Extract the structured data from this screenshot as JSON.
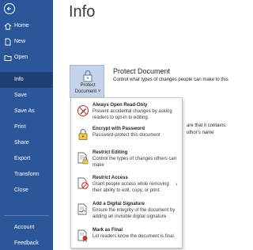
{
  "sidebar": {
    "items": [
      {
        "label": "Home"
      },
      {
        "label": "New"
      },
      {
        "label": "Open"
      },
      {
        "label": "Info"
      },
      {
        "label": "Save"
      },
      {
        "label": "Save As"
      },
      {
        "label": "Print"
      },
      {
        "label": "Share"
      },
      {
        "label": "Export"
      },
      {
        "label": "Transform"
      },
      {
        "label": "Close"
      },
      {
        "label": "Account"
      },
      {
        "label": "Feedback"
      }
    ],
    "active": "Info"
  },
  "main": {
    "title": "Info",
    "protect_button": {
      "line1": "Protect",
      "line2": "Document ˅"
    },
    "section_title": "Protect Document",
    "section_desc": "Control what types of changes people can make to this",
    "bg_text_1": "are that it contains:",
    "bg_text_2": "uthor's name"
  },
  "menu": {
    "items": [
      {
        "title": "Always Open Read-Only",
        "desc": "Prevent accidental changes by asking readers to opt-in to editing.",
        "icon": "pencil-no-edit-icon"
      },
      {
        "title": "Encrypt with Password",
        "desc": "Password-protect this document",
        "icon": "lock-key-icon"
      },
      {
        "title": "Restrict Editing",
        "desc": "Control the types of changes others can make",
        "icon": "document-lock-icon"
      },
      {
        "title": "Restrict Access",
        "desc": "Grant people access while removing their ability to edit, copy, or print.",
        "icon": "restrict-access-icon"
      },
      {
        "title": "Add a Digital Signature",
        "desc": "Ensure the integrity of the document by adding an invisible digital signature",
        "icon": "digital-signature-icon"
      },
      {
        "title": "Mark as Final",
        "desc": "Let readers know the document is final.",
        "icon": "mark-final-icon"
      }
    ]
  },
  "colors": {
    "sidebar": "#2b579a",
    "active": "#1e3f73",
    "button": "#c5d3ea"
  }
}
